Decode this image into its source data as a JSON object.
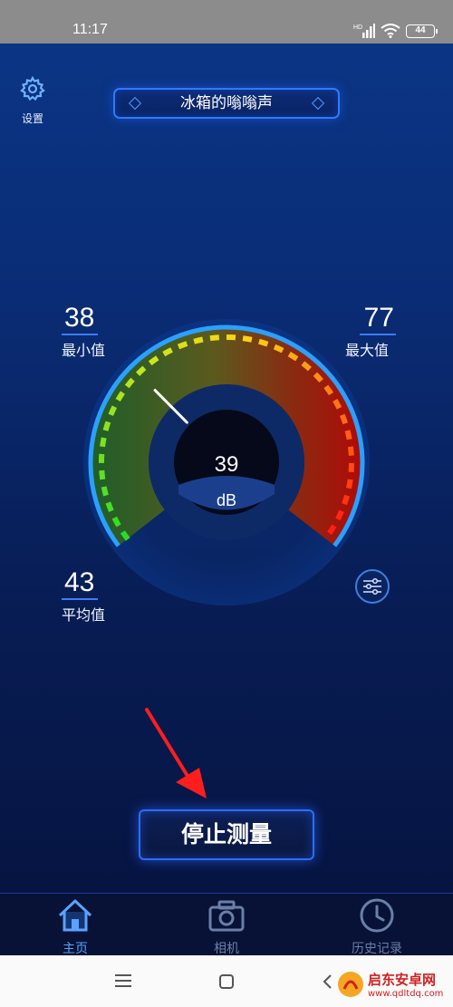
{
  "status_bar": {
    "time": "11:17",
    "network": "HD",
    "battery": "44"
  },
  "header": {
    "settings_label": "设置",
    "scene_title": "冰箱的嗡嗡声"
  },
  "stats": {
    "min": {
      "value": "38",
      "label": "最小值"
    },
    "max": {
      "value": "77",
      "label": "最大值"
    },
    "avg": {
      "value": "43",
      "label": "平均值"
    }
  },
  "gauge": {
    "current_value": "39",
    "unit": "dB",
    "level": 39
  },
  "actions": {
    "stop_label": "停止测量"
  },
  "tabs": [
    {
      "label": "主页",
      "icon": "home-icon",
      "active": true
    },
    {
      "label": "相机",
      "icon": "camera-icon",
      "active": false
    },
    {
      "label": "历史记录",
      "icon": "clock-icon",
      "active": false
    }
  ],
  "system_nav": {
    "menu": "menu-icon",
    "home": "home-square-icon",
    "back": "back-icon"
  },
  "watermark": {
    "brand": "启东安卓网",
    "url": "www.qdltdq.com"
  },
  "colors": {
    "accent": "#2d7bff",
    "active_tab": "#5aa2ff",
    "inactive_tab": "#6b7fa8"
  }
}
